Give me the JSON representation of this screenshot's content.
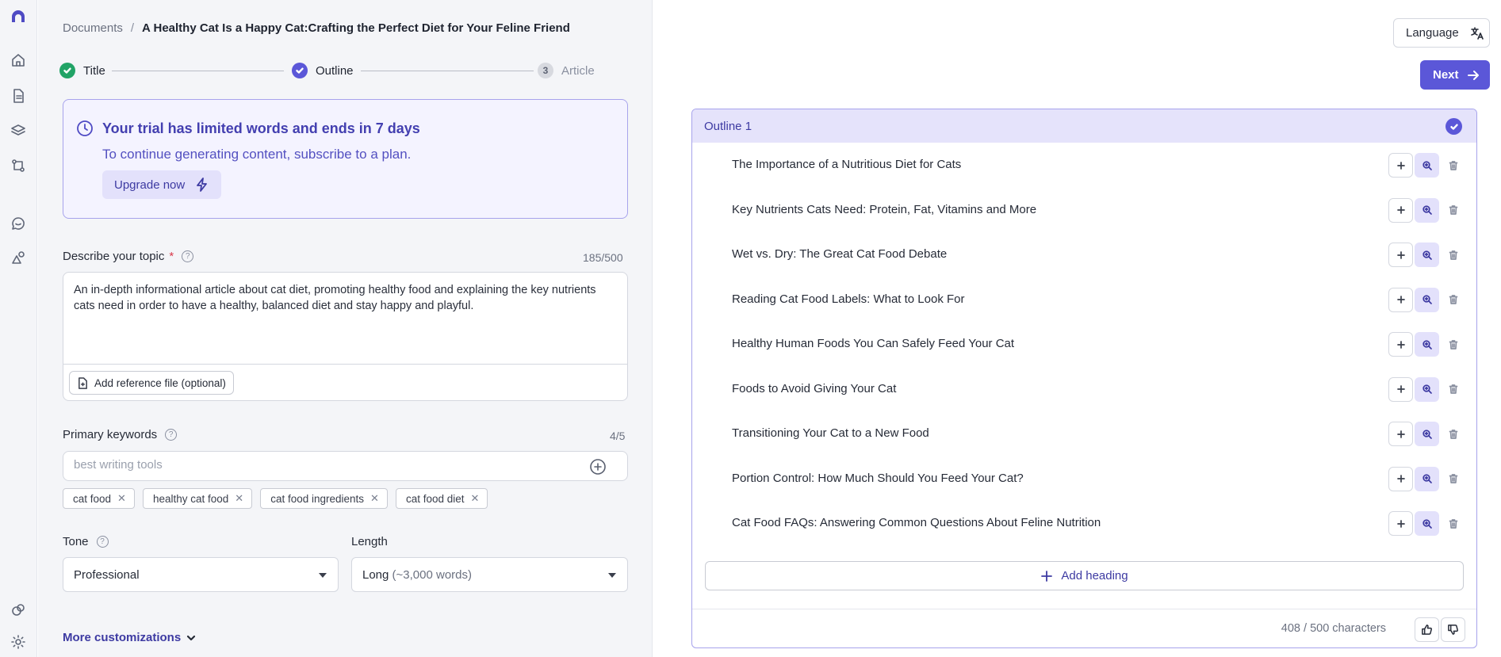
{
  "rail": {
    "icons": [
      "logo-icon",
      "home-icon",
      "documents-icon",
      "layers-icon",
      "workflow-icon",
      "chat-icon",
      "shapes-icon",
      "integrations-icon",
      "settings-icon"
    ]
  },
  "breadcrumb": {
    "parent": "Documents",
    "separator": "/",
    "current": "A Healthy Cat Is a Happy Cat:Crafting the Perfect Diet for Your Feline Friend"
  },
  "steps": [
    {
      "label": "Title",
      "state": "done"
    },
    {
      "label": "Outline",
      "state": "current"
    },
    {
      "label": "Article",
      "number": "3",
      "state": "pending"
    }
  ],
  "trial": {
    "title": "Your trial has limited words and ends in 7 days",
    "subtitle": "To continue generating content, subscribe to a plan.",
    "upgrade_label": "Upgrade now"
  },
  "topic": {
    "label": "Describe your topic",
    "required_mark": "*",
    "counter": "185/500",
    "text": "An in-depth informational article about cat diet, promoting healthy food and explaining the key nutrients cats need in order to have a healthy, balanced diet and stay happy and playful.",
    "ref_file_label": "Add reference file (optional)"
  },
  "keywords": {
    "label": "Primary keywords",
    "counter": "4/5",
    "placeholder": "best writing tools",
    "tags": [
      "cat food",
      "healthy cat food",
      "cat food ingredients",
      "cat food diet"
    ]
  },
  "tone": {
    "label": "Tone",
    "value": "Professional"
  },
  "length": {
    "label": "Length",
    "value": "Long",
    "detail": "(~3,000 words)"
  },
  "more_customizations": "More customizations",
  "header": {
    "language_label": "Language",
    "next_label": "Next"
  },
  "outline": {
    "title": "Outline 1",
    "items": [
      "The Importance of a Nutritious Diet for Cats",
      "Key Nutrients Cats Need: Protein, Fat, Vitamins and More",
      "Wet vs. Dry: The Great Cat Food Debate",
      "Reading Cat Food Labels: What to Look For",
      "Healthy Human Foods You Can Safely Feed Your Cat",
      "Foods to Avoid Giving Your Cat",
      "Transitioning Your Cat to a New Food",
      "Portion Control: How Much Should You Feed Your Cat?",
      "Cat Food FAQs: Answering Common Questions About Feline Nutrition"
    ],
    "add_heading_label": "Add heading",
    "char_count": "408 / 500 characters"
  },
  "colors": {
    "accent": "#5b57d8",
    "accent_light": "#e5e3fb",
    "success": "#21a366"
  }
}
